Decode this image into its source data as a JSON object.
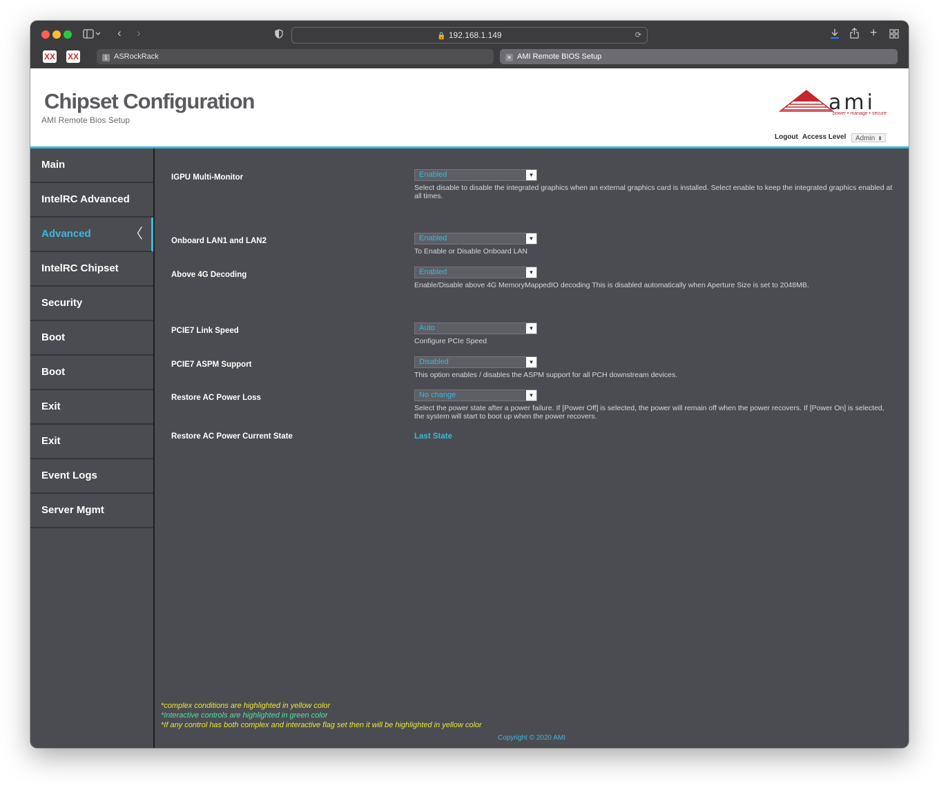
{
  "browser": {
    "url": "192.168.1.149",
    "tabs": [
      {
        "index_badge": "1",
        "label": "ASRockRack"
      },
      {
        "label": "AMI Remote BIOS Setup"
      }
    ],
    "pinned_tab_glyph": "XX"
  },
  "header": {
    "title": "Chipset Configuration",
    "subtitle": "AMI Remote Bios Setup",
    "logo_text": "ami",
    "logo_tagline": "power • manage • secure",
    "logout_label": "Logout",
    "access_level_label": "Access Level",
    "access_level_value": "Admin"
  },
  "sidebar": {
    "items": [
      {
        "label": "Main"
      },
      {
        "label": "IntelRC Advanced"
      },
      {
        "label": "Advanced",
        "active": true
      },
      {
        "label": "IntelRC Chipset"
      },
      {
        "label": "Security"
      },
      {
        "label": "Boot"
      },
      {
        "label": "Boot"
      },
      {
        "label": "Exit"
      },
      {
        "label": "Exit"
      },
      {
        "label": "Event Logs"
      },
      {
        "label": "Server Mgmt"
      }
    ]
  },
  "settings": [
    {
      "label": "IGPU Multi-Monitor",
      "value": "Enabled",
      "help": "Select disable to disable the integrated graphics when an external graphics card is installed. Select enable to keep the integrated graphics enabled at all times."
    },
    {
      "label": "Onboard LAN1 and LAN2",
      "value": "Enabled",
      "help": "To Enable or Disable Onboard LAN"
    },
    {
      "label": "Above 4G Decoding",
      "value": "Enabled",
      "help": "Enable/Disable above 4G MemoryMappedIO decoding This is disabled automatically when Aperture Size is set to 2048MB."
    },
    {
      "label": "PCIE7 Link Speed",
      "value": "Auto",
      "help": "Configure PCIe Speed"
    },
    {
      "label": "PCIE7 ASPM Support",
      "value": "Disabled",
      "help": "This option enables / disables the ASPM support for all PCH downstream devices."
    },
    {
      "label": "Restore AC Power Loss",
      "value": "No change",
      "help": "Select the power state after a power failure. If [Power Off] is selected, the power will remain off when the power recovers. If [Power On] is selected, the system will start to boot up when the power recovers."
    },
    {
      "label": "Restore AC Power Current State",
      "value": "Last State"
    }
  ],
  "notes": [
    "*complex conditions are highlighted in yellow color",
    "*Interactive controls are highlighted in green color",
    "*If any control has both complex and interactive flag set then it will be highlighted in yellow color"
  ],
  "footer": {
    "copyright": "Copyright © 2020 AMI"
  },
  "colors": {
    "accent": "#3fb6d8",
    "panel": "#4b4c52",
    "note_yellow": "#e8e830",
    "note_green": "#4fe3a0"
  }
}
